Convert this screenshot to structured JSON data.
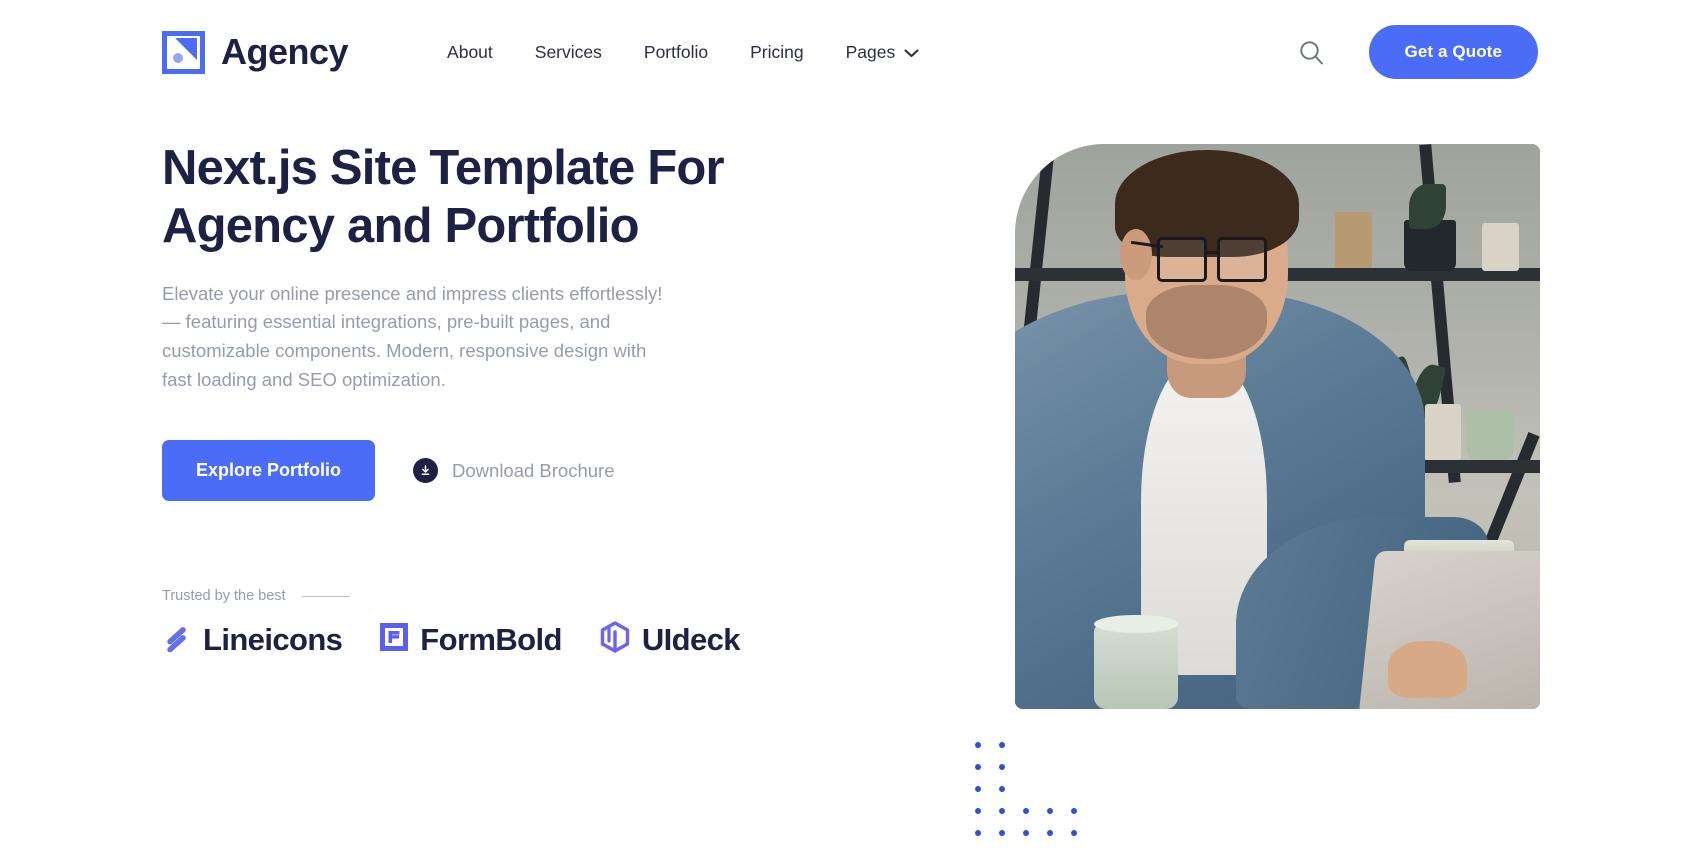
{
  "brand": {
    "name": "Agency",
    "logo_icon": "agency-triangle-circle-icon",
    "accent_color": "#4a6cf7",
    "dark_color": "#1d2144"
  },
  "header": {
    "nav": [
      {
        "label": "About",
        "has_dropdown": false
      },
      {
        "label": "Services",
        "has_dropdown": false
      },
      {
        "label": "Portfolio",
        "has_dropdown": false
      },
      {
        "label": "Pricing",
        "has_dropdown": false
      },
      {
        "label": "Pages",
        "has_dropdown": true
      }
    ],
    "search_icon": "search-icon",
    "chevron_icon": "chevron-down-icon",
    "cta_label": "Get a Quote"
  },
  "hero": {
    "title": "Next.js Site Template For Agency and Portfolio",
    "subtitle": "Elevate your online presence and impress clients effortlessly! — featuring essential integrations, pre-built pages, and customizable components. Modern, responsive design with fast loading and SEO optimization.",
    "primary_cta": "Explore Portfolio",
    "secondary_cta": "Download Brochure",
    "secondary_icon": "download-circle-icon",
    "image_alt": "man-with-glasses-working-on-laptop-at-desk"
  },
  "trusted": {
    "label": "Trusted by the best",
    "logos": [
      {
        "name": "Lineicons",
        "icon": "lineicons-slash-icon",
        "color": "#5f6fef"
      },
      {
        "name": "FormBold",
        "icon": "formbold-square-f-icon",
        "color": "#5b5ff0"
      },
      {
        "name": "UIdeck",
        "icon": "uideck-cube-icon",
        "color": "#6c63ef"
      }
    ]
  },
  "decoration": {
    "dot_grid_color": "#2c51d8",
    "dot_grid_cols": 5,
    "dot_grid_rows": 5
  }
}
